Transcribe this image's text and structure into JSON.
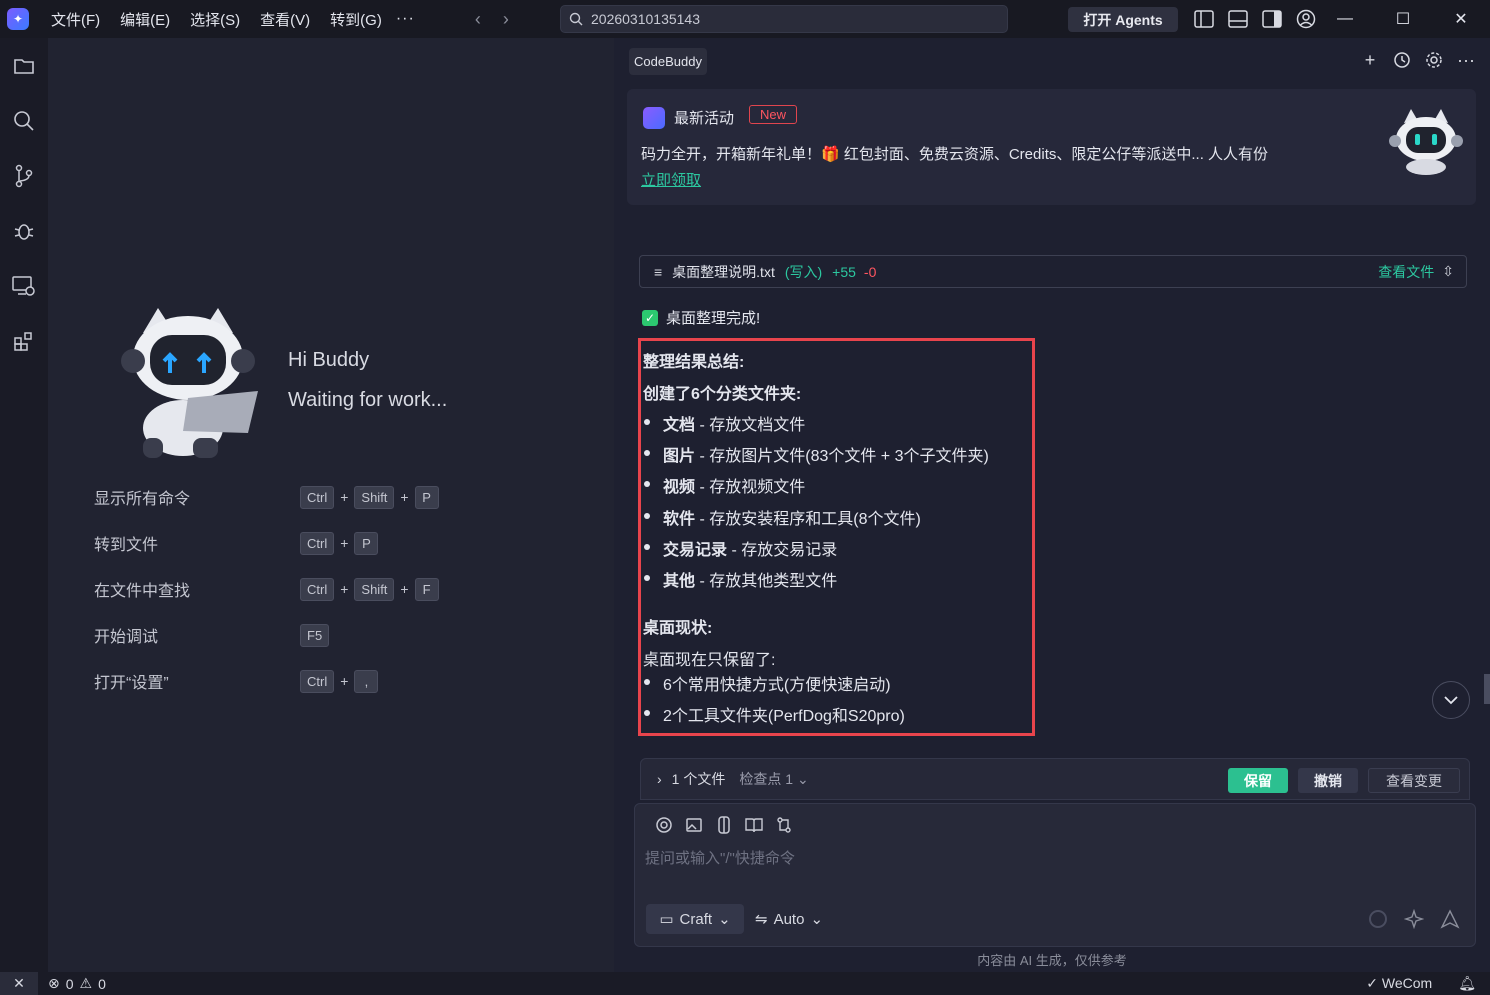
{
  "titlebar": {
    "menu": [
      "文件(F)",
      "编辑(E)",
      "选择(S)",
      "查看(V)",
      "转到(G)"
    ],
    "more": "···",
    "search": "20260310135143",
    "open_agents": "打开 Agents"
  },
  "welcome": {
    "greeting": "Hi Buddy",
    "status": "Waiting for work...",
    "shortcuts": [
      {
        "label": "显示所有命令",
        "keys": [
          "Ctrl",
          "Shift",
          "P"
        ]
      },
      {
        "label": "转到文件",
        "keys": [
          "Ctrl",
          "P"
        ]
      },
      {
        "label": "在文件中查找",
        "keys": [
          "Ctrl",
          "Shift",
          "F"
        ]
      },
      {
        "label": "开始调试",
        "keys": [
          "F5"
        ]
      },
      {
        "label": "打开“设置”",
        "keys": [
          "Ctrl",
          ","
        ]
      }
    ]
  },
  "panel": {
    "tab": "CodeBuddy",
    "promo": {
      "title": "最新活动",
      "badge": "New",
      "text": "码力全开，开箱新年礼单！🎁 红包封面、免费云资源、Credits、限定公仔等派送中... 人人有份",
      "link": "立即领取"
    },
    "file_card": {
      "name": "桌面整理说明.txt",
      "mode": "(写入)",
      "added": "+55",
      "removed": "-0",
      "view": "查看文件"
    },
    "done": "桌面整理完成!",
    "summary": {
      "heading": "整理结果总结:",
      "created": "创建了6个分类文件夹:",
      "folders": [
        {
          "name": "文档",
          "desc": " - 存放文档文件"
        },
        {
          "name": "图片",
          "desc": " - 存放图片文件(83个文件 + 3个子文件夹)"
        },
        {
          "name": "视频",
          "desc": " - 存放视频文件"
        },
        {
          "name": "软件",
          "desc": " - 存放安装程序和工具(8个文件)"
        },
        {
          "name": "交易记录",
          "desc": " - 存放交易记录"
        },
        {
          "name": "其他",
          "desc": " - 存放其他类型文件"
        }
      ],
      "status_heading": "桌面现状:",
      "status_intro": "桌面现在只保留了:",
      "kept": [
        "6个常用快捷方式(方便快速启动)",
        "2个工具文件夹(PerfDog和S20pro)"
      ]
    },
    "changes": {
      "files": "1 个文件",
      "checkpoint": "检查点 1",
      "keep": "保留",
      "undo": "撤销",
      "view": "查看变更"
    },
    "composer": {
      "placeholder": "提问或输入\"/\"快捷命令",
      "mode": "Craft",
      "model": "Auto"
    },
    "disclaimer": "内容由 AI 生成，仅供参考"
  },
  "statusbar": {
    "errors": "0",
    "warnings": "0",
    "wecom": "WeCom"
  },
  "colors": {
    "accent": "#2cc8a0",
    "highlight_border": "#e8444c",
    "new_badge": "#ff5560"
  }
}
